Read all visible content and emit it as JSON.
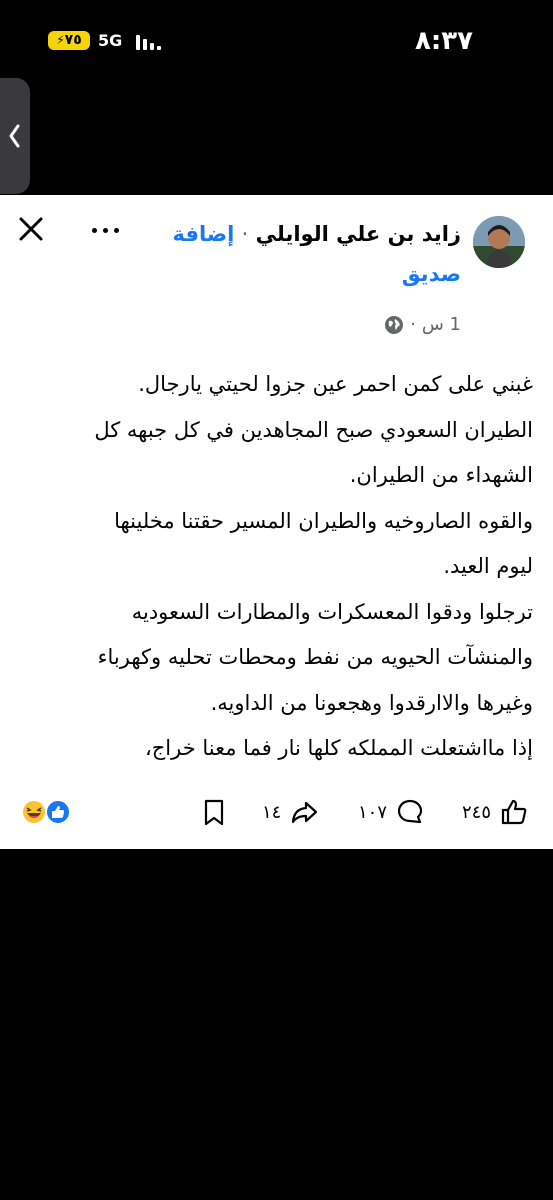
{
  "status_bar": {
    "time": "٨:٣٧",
    "battery": "٧٥",
    "network": "5G"
  },
  "post": {
    "author": "زايد بن علي الوايلي",
    "separator": "·",
    "add_friend": "إضافة صديق",
    "time": "1 س",
    "time_separator": "·",
    "lines": [
      "غبني على كمن احمر عين  جزوا لحيتي يارجال.",
      "الطيران السعودي صبح المجاهدين في كل جبهه  كل",
      "الشهداء من الطيران.",
      "والقوه الصاروخيه والطيران المسير حقتنا مخلينها",
      "ليوم العيد.",
      "ترجلوا ودقوا المعسكرات والمطارات السعوديه",
      "والمنشآت الحيويه من نفط ومحطات تحليه وكهرباء",
      "وغيرها والاارقدوا وهجعونا من الداويه.",
      "إذا مااشتعلت المملكه كلها نار فما معنا خراج،"
    ],
    "likes_count": "٢٤٥",
    "comments_count": "١٠٧",
    "shares_count": "١٤"
  },
  "icons": {
    "back": "chevron-left-icon",
    "more": "more-dots-icon",
    "close": "close-icon",
    "privacy": "globe-icon",
    "like": "thumbs-up-icon",
    "comment": "comment-icon",
    "share": "share-icon",
    "save": "bookmark-icon"
  },
  "colors": {
    "link": "#1877f2",
    "text": "#050505",
    "muted": "#65676b",
    "battery": "#f5d40c"
  }
}
